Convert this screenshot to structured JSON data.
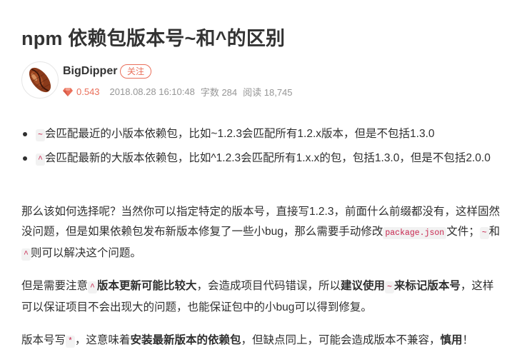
{
  "article": {
    "title": "npm 依赖包版本号~和^的区别"
  },
  "author": {
    "name": "BigDipper",
    "follow_label": "关注",
    "diamond_value": "0.543",
    "datetime": "2018.08.28 16:10:48",
    "word_count": "字数 284",
    "read_count": "阅读 18,745",
    "avatar_icon": "coffee-bean-icon"
  },
  "colors": {
    "accent": "#ea6f5a",
    "code_text": "#c7254e",
    "code_bg": "#f2f2f2",
    "meta_text": "#969696"
  },
  "bullets": [
    {
      "code": "~",
      "text": "会匹配最近的小版本依赖包，比如~1.2.3会匹配所有1.2.x版本，但是不包括1.3.0"
    },
    {
      "code": "^",
      "text": "会匹配最新的大版本依赖包，比如^1.2.3会匹配所有1.x.x的包，包括1.3.0，但是不包括2.0.0"
    }
  ],
  "para1": {
    "text1": "那么该如何选择呢？当然你可以指定特定的版本号，直接写1.2.3，前面什么前缀都没有，这样固然没问题，但是如果依赖包发布新版本修复了一些小bug，那么需要手动修改",
    "code1": "package.json",
    "text2": "文件；",
    "code2": "~",
    "text3": "和",
    "code3": "^",
    "text4": "则可以解决这个问题。"
  },
  "para2": {
    "text1": "但是需要注意",
    "code1": "^",
    "bold1": "版本更新可能比较大",
    "text2": "，会造成项目代码错误，所以",
    "bold2": "建议使用",
    "code2": "~",
    "bold3": "来标记版本号",
    "text3": "，这样可以保证项目不会出现大的问题，也能保证包中的小bug可以得到修复。"
  },
  "para3": {
    "text1": "版本号写",
    "code1": "*",
    "text2": "，这意味着",
    "bold1": "安装最新版本的依赖包",
    "text3": "，但缺点同上，可能会造成版本不兼容，",
    "bold2": "慎用",
    "text4": "！"
  }
}
